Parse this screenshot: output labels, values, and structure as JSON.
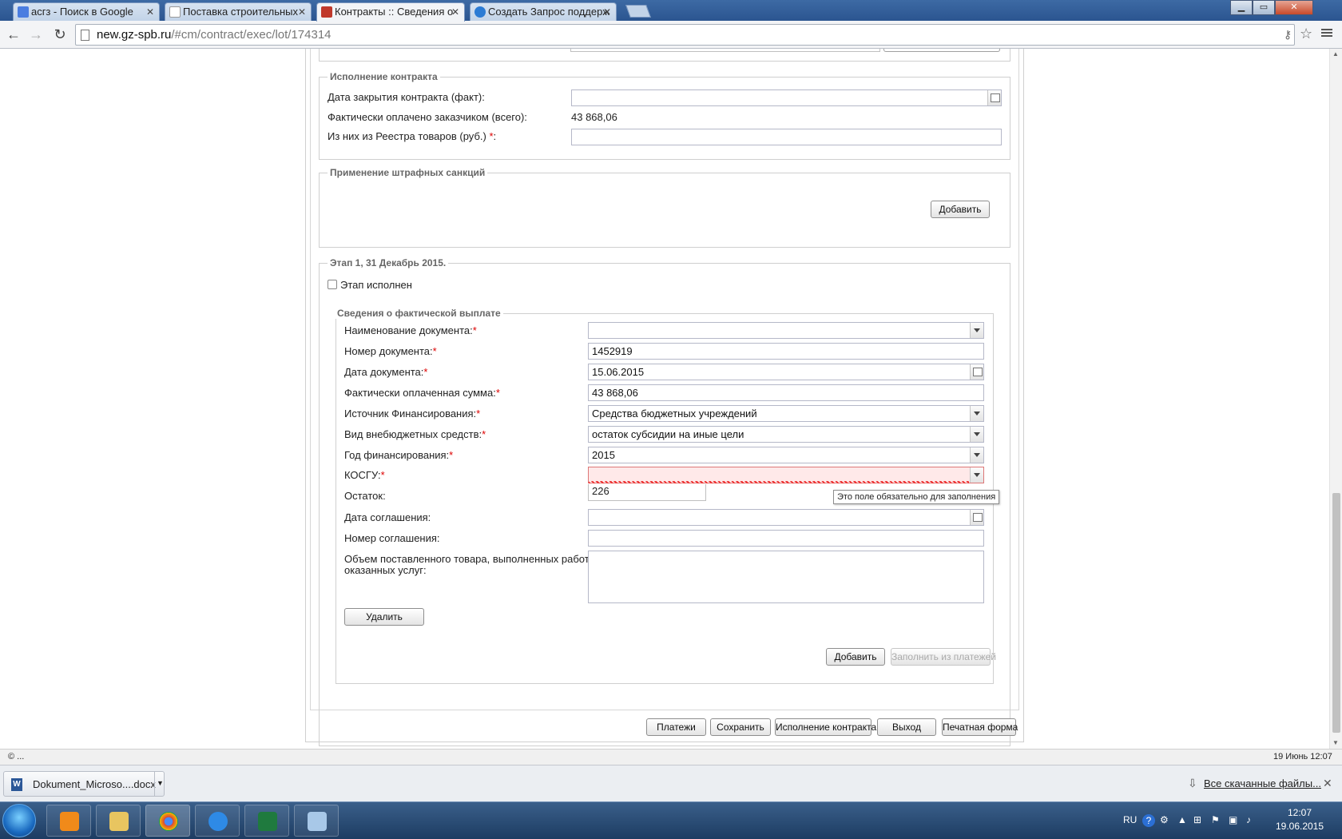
{
  "browser": {
    "tabs": [
      {
        "label": "асгз - Поиск в Google",
        "favicon_color": "#4a7de0"
      },
      {
        "label": "Поставка строительных",
        "favicon_color": "#ffffff"
      },
      {
        "label": "Контракты :: Сведения о",
        "favicon_color": "#c0392b"
      },
      {
        "label": "Создать Запрос поддерж",
        "favicon_color": "#2b7bd4"
      }
    ],
    "url_host": "new.gz-spb.ru",
    "url_path": "/#cm/contract/exec/lot/174314"
  },
  "execution": {
    "legend": "Исполнение контракта",
    "close_date_label": "Дата закрытия контракта (факт):",
    "paid_label": "Фактически оплачено заказчиком (всего):",
    "paid_value": "43 868,06",
    "registry_label": "Из них из Реестра товаров (руб.)",
    "req_mark": "*",
    "colon": ":"
  },
  "penalties": {
    "legend": "Применение штрафных санкций",
    "add_label": "Добавить"
  },
  "stage": {
    "legend": "Этап 1, 31 Декабрь 2015.",
    "done_label": "Этап исполнен",
    "done_checked": false,
    "payment": {
      "legend": "Сведения о фактической выплате",
      "doc_name_label": "Наименование документа:",
      "doc_num_label": "Номер документа:",
      "doc_num_value": "1452919",
      "doc_date_label": "Дата документа:",
      "doc_date_value": "15.06.2015",
      "sum_label": "Фактически оплаченная сумма:",
      "sum_value": "43 868,06",
      "source_label": "Источник Финансирования:",
      "source_value": "Средства бюджетных учреждений",
      "kind_label": "Вид внебюджетных средств:",
      "kind_value": "остаток субсидии на иные цели",
      "year_label": "Год финансирования:",
      "year_value": "2015",
      "kosgu_label": "КОСГУ:",
      "kosgu_option": "226",
      "kosgu_error": "Это поле обязательно для заполнения",
      "rest_label": "Остаток:",
      "agr_date_label": "Дата соглашения:",
      "agr_num_label": "Номер соглашения:",
      "volume_label_1": "Объем поставленного товара, выполненных работ,",
      "volume_label_2": "оказанных услуг:",
      "delete_label": "Удалить"
    },
    "add_label": "Добавить",
    "fill_label": "Заполнить из платежей"
  },
  "footer_buttons": {
    "payments": "Платежи",
    "save": "Сохранить",
    "exec": "Исполнение контракта",
    "exit": "Выход",
    "print": "Печатная форма"
  },
  "status": {
    "left": "© ...",
    "right": "19 Июнь 12:07"
  },
  "downloads": {
    "file": "Dokument_Microso....docx",
    "all": "Все скачанные файлы..."
  },
  "taskbar": {
    "lang": "RU",
    "time": "12:07",
    "date": "19.06.2015"
  }
}
